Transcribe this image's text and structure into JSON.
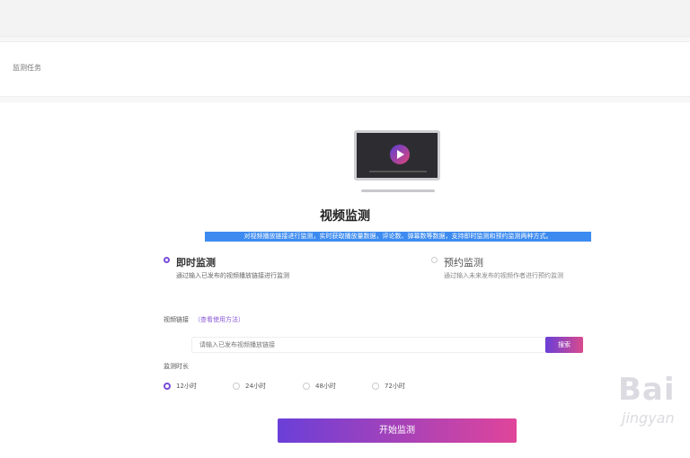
{
  "breadcrumb": "监测任务",
  "hero": {
    "title": "视频监测",
    "description": "对视频播放链接进行监测，实时获取播放量数据，评论数、弹幕数等数据，支持即时监测和预约监测两种方式。"
  },
  "modes": [
    {
      "label": "即时监测",
      "description": "通过输入已发布的视频播放链接进行监测",
      "selected": true
    },
    {
      "label": "预约监测",
      "description": "通过输入未来发布的视频作者进行预约监测",
      "selected": false
    }
  ],
  "link_section": {
    "label": "视频链接",
    "help": "（查看使用方法）",
    "placeholder": "请输入已发布视频播放链接",
    "search_label": "搜索"
  },
  "duration": {
    "label": "监测时长",
    "options": [
      {
        "label": "12小时",
        "selected": true
      },
      {
        "label": "24小时",
        "selected": false
      },
      {
        "label": "48小时",
        "selected": false
      },
      {
        "label": "72小时",
        "selected": false
      }
    ]
  },
  "start_button": "开始监测",
  "watermark": {
    "main": "Bai",
    "sub": "jingyan"
  },
  "colors": {
    "accent_start": "#6a3fd8",
    "accent_end": "#e0459a",
    "highlight": "#3d8bf0"
  }
}
